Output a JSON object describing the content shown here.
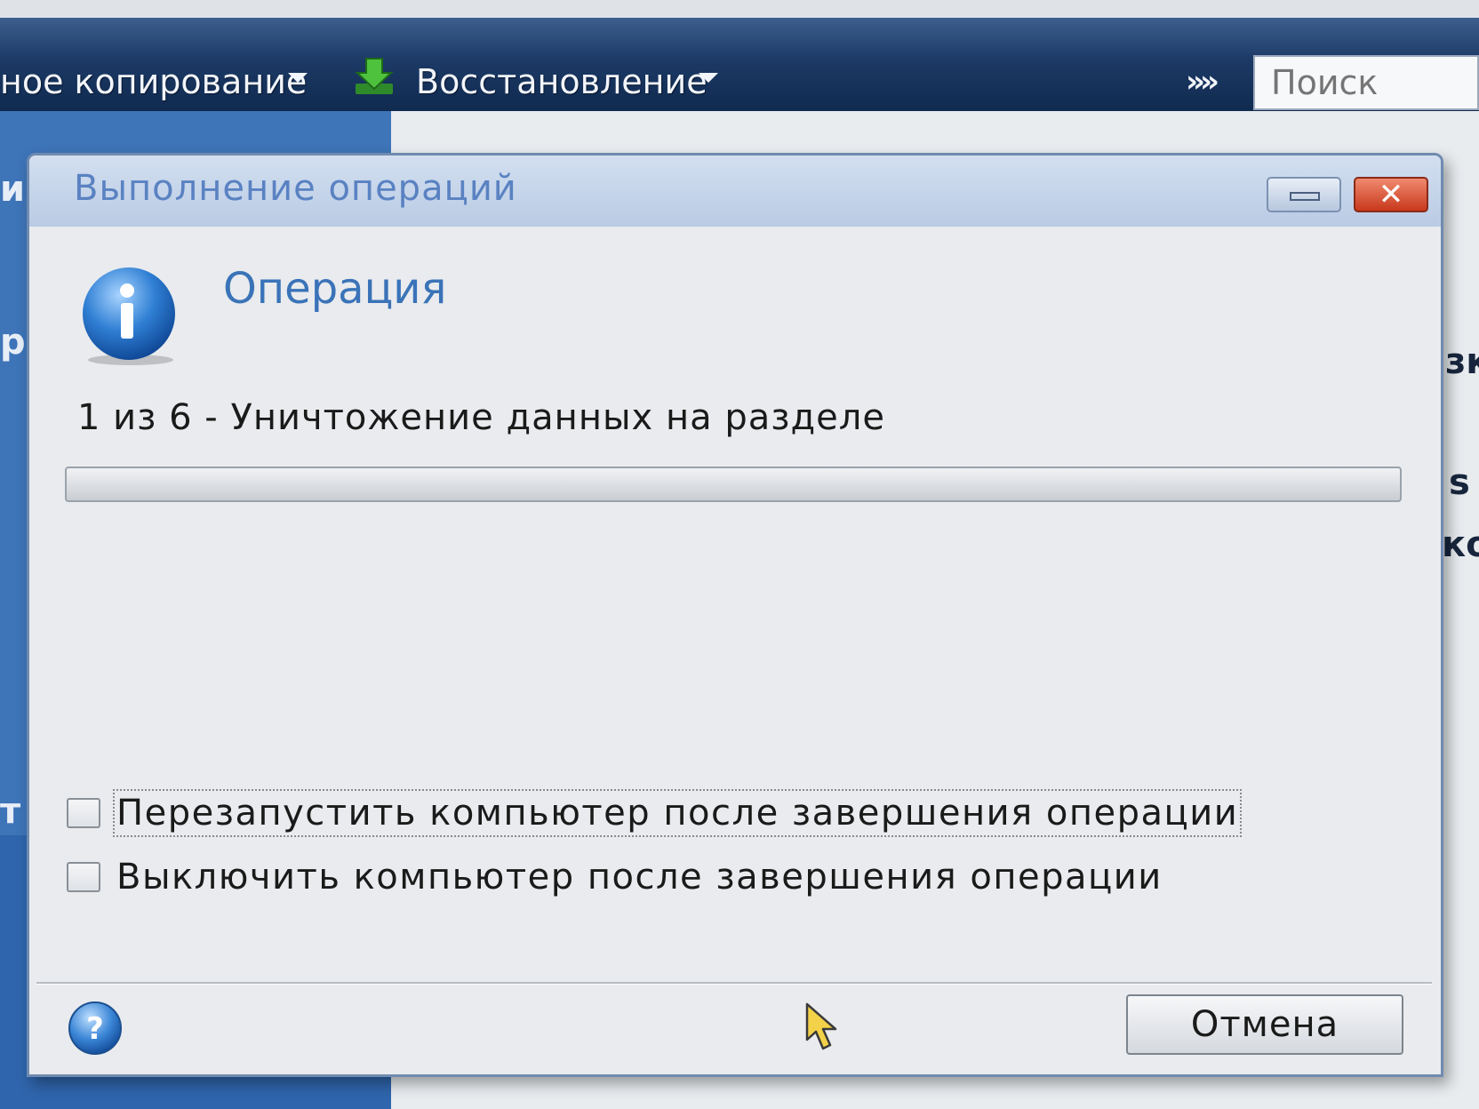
{
  "app": {
    "toolbar": {
      "backup_label": "ное копирование",
      "restore_label": "Восстановление",
      "more_label": "»",
      "search_placeholder": "Поиск"
    },
    "background_fragments": {
      "left_1": "и",
      "left_2": "р",
      "left_3": "т",
      "right_1": "зк",
      "right_2": "s",
      "right_3": "ко"
    }
  },
  "dialog": {
    "title": "Выполнение операций",
    "heading": "Операция",
    "status": "1 из 6 - Уничтожение данных на разделе",
    "progress_percent": 0,
    "checkboxes": [
      {
        "label": "Перезапустить компьютер после завершения операции",
        "checked": false
      },
      {
        "label": "Выключить компьютер после завершения операции",
        "checked": false
      }
    ],
    "cancel_label": "Отмена"
  },
  "icons": {
    "dialog": "info-icon",
    "footer": "help-icon",
    "toolbar_restore": "restore-arrow-icon"
  },
  "colors": {
    "toolbar": "#1c3a66",
    "dialog_title": "#5a82c2",
    "heading": "#3a73b8",
    "close_button": "#c8381c"
  }
}
